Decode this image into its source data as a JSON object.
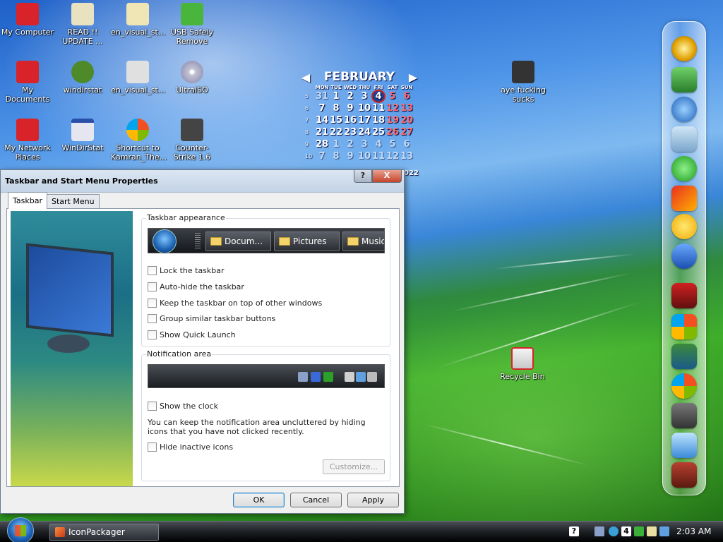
{
  "desktop": {
    "icons": [
      {
        "label": "My Computer",
        "color": "#d8232a"
      },
      {
        "label": "READ !! UPDATE ...",
        "color": "#e8e2c0"
      },
      {
        "label": "en_visual_st...",
        "color": "#f0e6b5"
      },
      {
        "label": "USB Safely Remove",
        "color": "#49b53c"
      },
      {
        "label": "My Documents",
        "color": "#d8232a"
      },
      {
        "label": "windirstat",
        "color": "#4e8a2a"
      },
      {
        "label": "en_visual_st...",
        "color": "#e0e0e0"
      },
      {
        "label": "UltraISO",
        "color": "#c8c8d8"
      },
      {
        "label": "My Network Places",
        "color": "#d8232a"
      },
      {
        "label": "WinDirStat",
        "color": "#e6e6f0"
      },
      {
        "label": "Shortcut to Kamran_The...",
        "color": "#3f8fdc"
      },
      {
        "label": "Counter-Strike 1.6",
        "color": "#444444"
      },
      {
        "label": "aye fucking sucks",
        "color": "#333333"
      },
      {
        "label": "Recycle Bin",
        "color": "#e6e6e6"
      }
    ]
  },
  "calendar": {
    "month": "FEBRUARY",
    "prev_arrow": "◀",
    "next_arrow": "▶",
    "weekdays": [
      "MON",
      "TUE",
      "WED",
      "THU",
      "FRI",
      "SAT",
      "SUN"
    ],
    "weeks": [
      {
        "num": "5",
        "days": [
          "31",
          "1",
          "2",
          "3",
          "4",
          "5",
          "6"
        ]
      },
      {
        "num": "6",
        "days": [
          "7",
          "8",
          "9",
          "10",
          "11",
          "12",
          "13"
        ]
      },
      {
        "num": "7",
        "days": [
          "14",
          "15",
          "16",
          "17",
          "18",
          "19",
          "20"
        ]
      },
      {
        "num": "8",
        "days": [
          "21",
          "22",
          "23",
          "24",
          "25",
          "26",
          "27"
        ]
      },
      {
        "num": "9",
        "days": [
          "28",
          "1",
          "2",
          "3",
          "4",
          "5",
          "6"
        ]
      },
      {
        "num": "10",
        "days": [
          "7",
          "8",
          "9",
          "10",
          "11",
          "12",
          "13"
        ]
      }
    ],
    "year_fragment": "022"
  },
  "dialog": {
    "title": "Taskbar and Start Menu Properties",
    "help_label": "?",
    "close_label": "X",
    "tabs": [
      {
        "label": "Taskbar",
        "active": true
      },
      {
        "label": "Start Menu",
        "active": false
      }
    ],
    "appearance": {
      "title": "Taskbar appearance",
      "preview_buttons": [
        "Docum...",
        "Pictures",
        "Music"
      ],
      "options": [
        {
          "label": "Lock the taskbar",
          "checked": false
        },
        {
          "label": "Auto-hide the taskbar",
          "checked": false
        },
        {
          "label": "Keep the taskbar on top of other windows",
          "checked": false
        },
        {
          "label": "Group similar taskbar buttons",
          "checked": false
        },
        {
          "label": "Show Quick Launch",
          "checked": false
        }
      ]
    },
    "notification": {
      "title": "Notification area",
      "show_clock_label": "Show the clock",
      "description": "You can keep the notification area uncluttered by hiding icons that you have not clicked recently.",
      "hide_inactive_label": "Hide inactive icons",
      "customize_label": "Customize..."
    },
    "buttons": {
      "ok": "OK",
      "cancel": "Cancel",
      "apply": "Apply"
    }
  },
  "taskbar": {
    "task_label": "IconPackager",
    "tray_badge": "4",
    "help_glyph": "?",
    "clock": "2:03 AM"
  }
}
